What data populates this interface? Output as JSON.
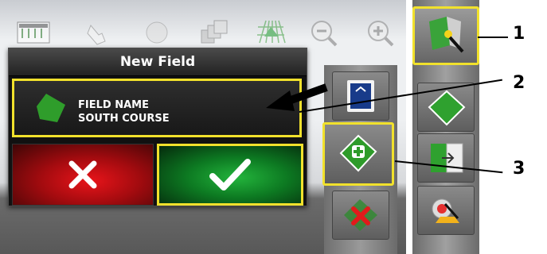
{
  "dialog": {
    "title": "New Field",
    "field_label": "FIELD NAME",
    "field_value": "SOUTH COURSE"
  },
  "callouts": [
    "1",
    "2",
    "3"
  ],
  "colors": {
    "highlight": "#f1e12c",
    "confirm": "#12952c",
    "cancel": "#d4141a",
    "field": "#2f9d2b"
  },
  "icons": {
    "toolbar": [
      "guidance-lines-icon",
      "touch-icon",
      "circle-icon",
      "layers-icon",
      "field-grid-icon",
      "zoom-out-icon",
      "zoom-in-icon"
    ],
    "strip": [
      "field-select-icon",
      "new-field-icon",
      "field-edit-icon",
      "field-import-icon",
      "field-delete-icon",
      "flag-icon",
      "boundary-icon"
    ]
  }
}
